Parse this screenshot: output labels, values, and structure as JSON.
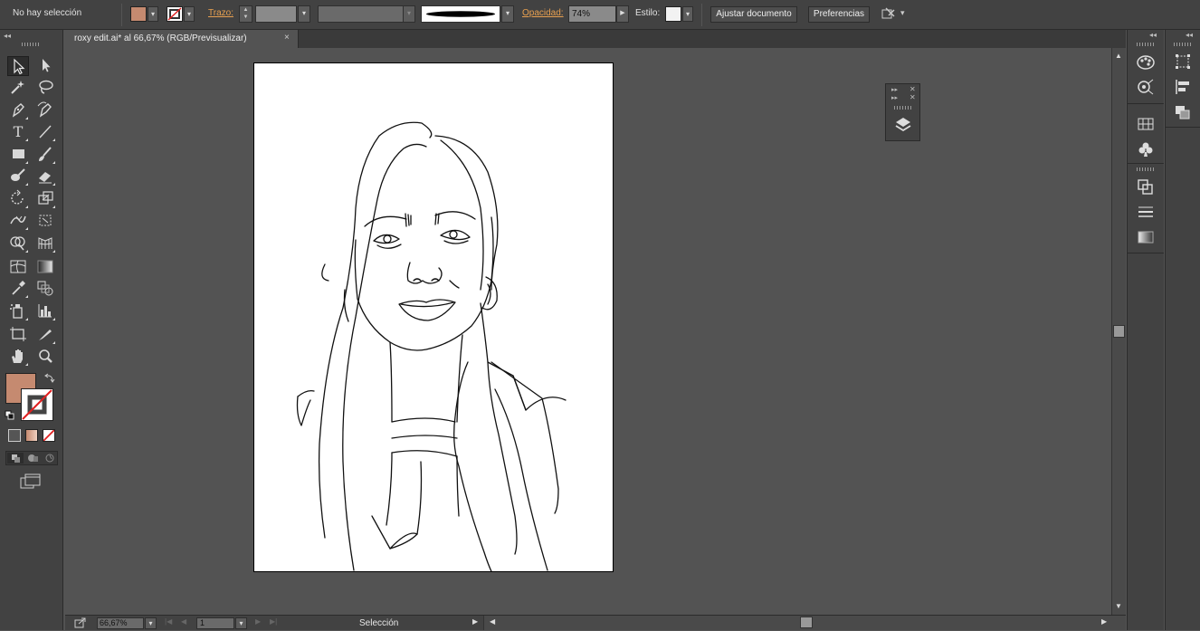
{
  "control_bar": {
    "selection_status": "No hay selección",
    "fill_color": "#c58a70",
    "stroke_label": "Trazo:",
    "opacity_label": "Opacidad:",
    "opacity_value": "74%",
    "style_label": "Estilo:",
    "fit_document_label": "Ajustar documento",
    "preferences_label": "Preferencias"
  },
  "document": {
    "tab_title": "roxy edit.ai* al 66,67% (RGB/Previsualizar)",
    "close_glyph": "×"
  },
  "status_bar": {
    "zoom_value": "66,67%",
    "artboard_number": "1",
    "current_tool": "Selección"
  },
  "toolbox": {
    "fill_color": "#c58a70",
    "stroke_color": "#ffffff",
    "accent_none": "#e02020"
  },
  "icons": {
    "collapse": "◂◂",
    "dropdown": "▾",
    "arrow_right": "▶",
    "arrow_left": "◀",
    "arrow_up": "▲",
    "arrow_down": "▼"
  }
}
